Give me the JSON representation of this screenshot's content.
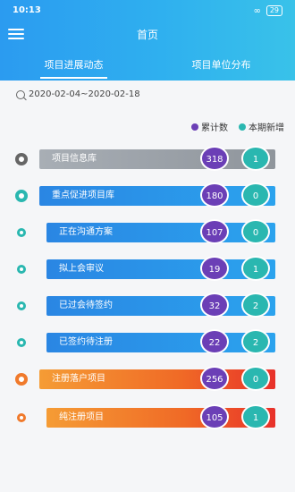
{
  "status_bar": {
    "time": "10:13",
    "signal_glyph": "∞",
    "battery": "29"
  },
  "header": {
    "title": "首页",
    "tabs": [
      "项目进展动态",
      "项目单位分布"
    ]
  },
  "date_range": "2020-02-04~2020-02-18",
  "legend": [
    {
      "label": "累计数",
      "color": "#6b3fb6"
    },
    {
      "label": "本期新增",
      "color": "#2ab7b0"
    }
  ],
  "rows": [
    {
      "label": "项目信息库",
      "cumulative": "318",
      "new": "1",
      "color": "#9aa1a8",
      "marker": "#666666"
    },
    {
      "label": "重点促进项目库",
      "cumulative": "180",
      "new": "0",
      "color": "#2a95e6",
      "marker": "#2ab7b0"
    },
    {
      "label": "正在沟通方案",
      "cumulative": "107",
      "new": "0",
      "color": "#2a95e6",
      "marker": "#2ab7b0"
    },
    {
      "label": "拟上会审议",
      "cumulative": "19",
      "new": "1",
      "color": "#2a95e6",
      "marker": "#2ab7b0"
    },
    {
      "label": "已过会待签约",
      "cumulative": "32",
      "new": "2",
      "color": "#2a95e6",
      "marker": "#2ab7b0"
    },
    {
      "label": "已签约待注册",
      "cumulative": "22",
      "new": "2",
      "color": "#2a95e6",
      "marker": "#2ab7b0"
    },
    {
      "label": "注册落户项目",
      "cumulative": "256",
      "new": "0",
      "color": "#f07a2c",
      "marker": "#f07a2c"
    },
    {
      "label": "纯注册项目",
      "cumulative": "105",
      "new": "1",
      "color": "#f07a2c",
      "marker": "#f07a2c"
    }
  ]
}
